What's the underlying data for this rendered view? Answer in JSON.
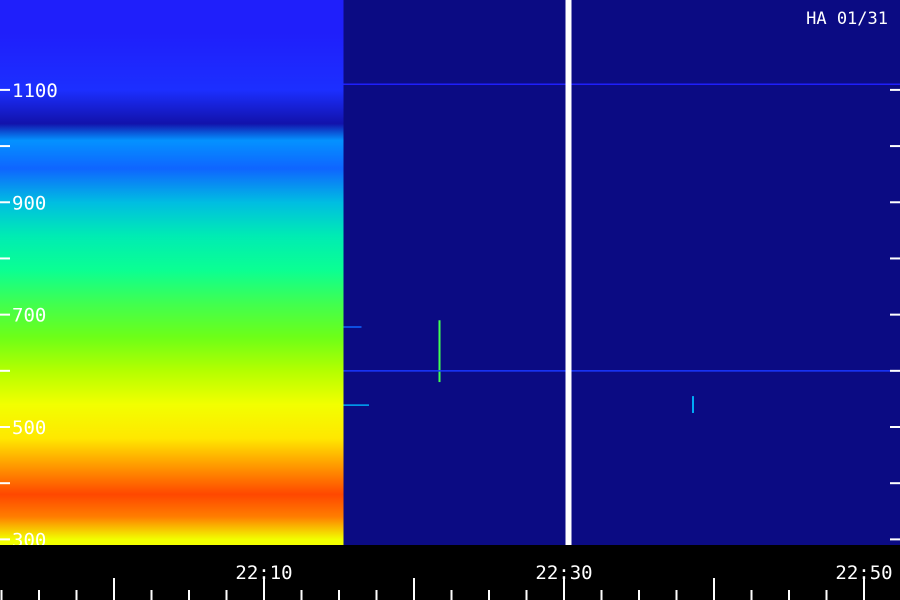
{
  "chart_data": {
    "type": "heatmap",
    "title": "HA 01/31",
    "xlabel": "",
    "ylabel": "",
    "x_tick_labels": [
      "22:10",
      "22:30",
      "22:50"
    ],
    "y_tick_labels": [
      "1100",
      "900",
      "700",
      "500",
      "300"
    ],
    "y_labeled_ticks": [
      1100,
      900,
      700,
      500,
      300
    ],
    "y_minor_ticks": [
      1000,
      800,
      600,
      400
    ],
    "ylim": [
      290,
      1260
    ],
    "xlim_minutes": [
      -7.6,
      52.4
    ],
    "x_labeled_ticks_minutes": [
      10,
      30,
      50
    ],
    "x_tick_step_minutes": 2.5,
    "grid": false,
    "legend": "none",
    "colormap": [
      "#000040",
      "#2020ff",
      "#00a0ff",
      "#00ffa0",
      "#80ff00",
      "#ffff00",
      "#ff8000",
      "#ff1000"
    ],
    "segments": [
      {
        "name": "",
        "x_range_minutes": [
          -7.6,
          15.3
        ],
        "band_intensity": [
          {
            "y": 300,
            "value": 0.7
          },
          {
            "y": 340,
            "value": 0.86
          },
          {
            "y": 380,
            "value": 0.93
          },
          {
            "y": 430,
            "value": 0.83
          },
          {
            "y": 480,
            "value": 0.74
          },
          {
            "y": 540,
            "value": 0.7
          },
          {
            "y": 600,
            "value": 0.63
          },
          {
            "y": 660,
            "value": 0.55
          },
          {
            "y": 720,
            "value": 0.5
          },
          {
            "y": 780,
            "value": 0.44
          },
          {
            "y": 840,
            "value": 0.4
          },
          {
            "y": 900,
            "value": 0.33
          },
          {
            "y": 960,
            "value": 0.22
          },
          {
            "y": 1010,
            "value": 0.27
          },
          {
            "y": 1040,
            "value": 0.08
          },
          {
            "y": 1100,
            "value": 0.16
          },
          {
            "y": 1200,
            "value": 0.14
          }
        ]
      },
      {
        "name": "",
        "x_range_minutes": [
          15.3,
          30.1
        ],
        "background": 0.05
      },
      {
        "name": "",
        "x_range_minutes": [
          30.5,
          52.4
        ],
        "background": 0.05
      }
    ],
    "gaps_minutes": [
      [
        30.1,
        30.5
      ]
    ],
    "features": [
      {
        "type": "vertical-streak",
        "x_minutes": 21.7,
        "y_range": [
          580,
          690
        ],
        "value": 0.5
      },
      {
        "type": "vertical-streak",
        "x_minutes": 38.6,
        "y_range": [
          525,
          555
        ],
        "value": 0.3
      },
      {
        "type": "horizontal-line",
        "x_range_minutes": [
          15.3,
          52.4
        ],
        "y": 600,
        "value": 0.17
      },
      {
        "type": "horizontal-line",
        "x_range_minutes": [
          15.3,
          52.4
        ],
        "y": 1110,
        "value": 0.14
      },
      {
        "type": "short-line",
        "x_range_minutes": [
          15.3,
          17.0
        ],
        "y": 539,
        "value": 0.3
      },
      {
        "type": "short-line",
        "x_range_minutes": [
          15.3,
          16.5
        ],
        "y": 678,
        "value": 0.22
      }
    ]
  }
}
